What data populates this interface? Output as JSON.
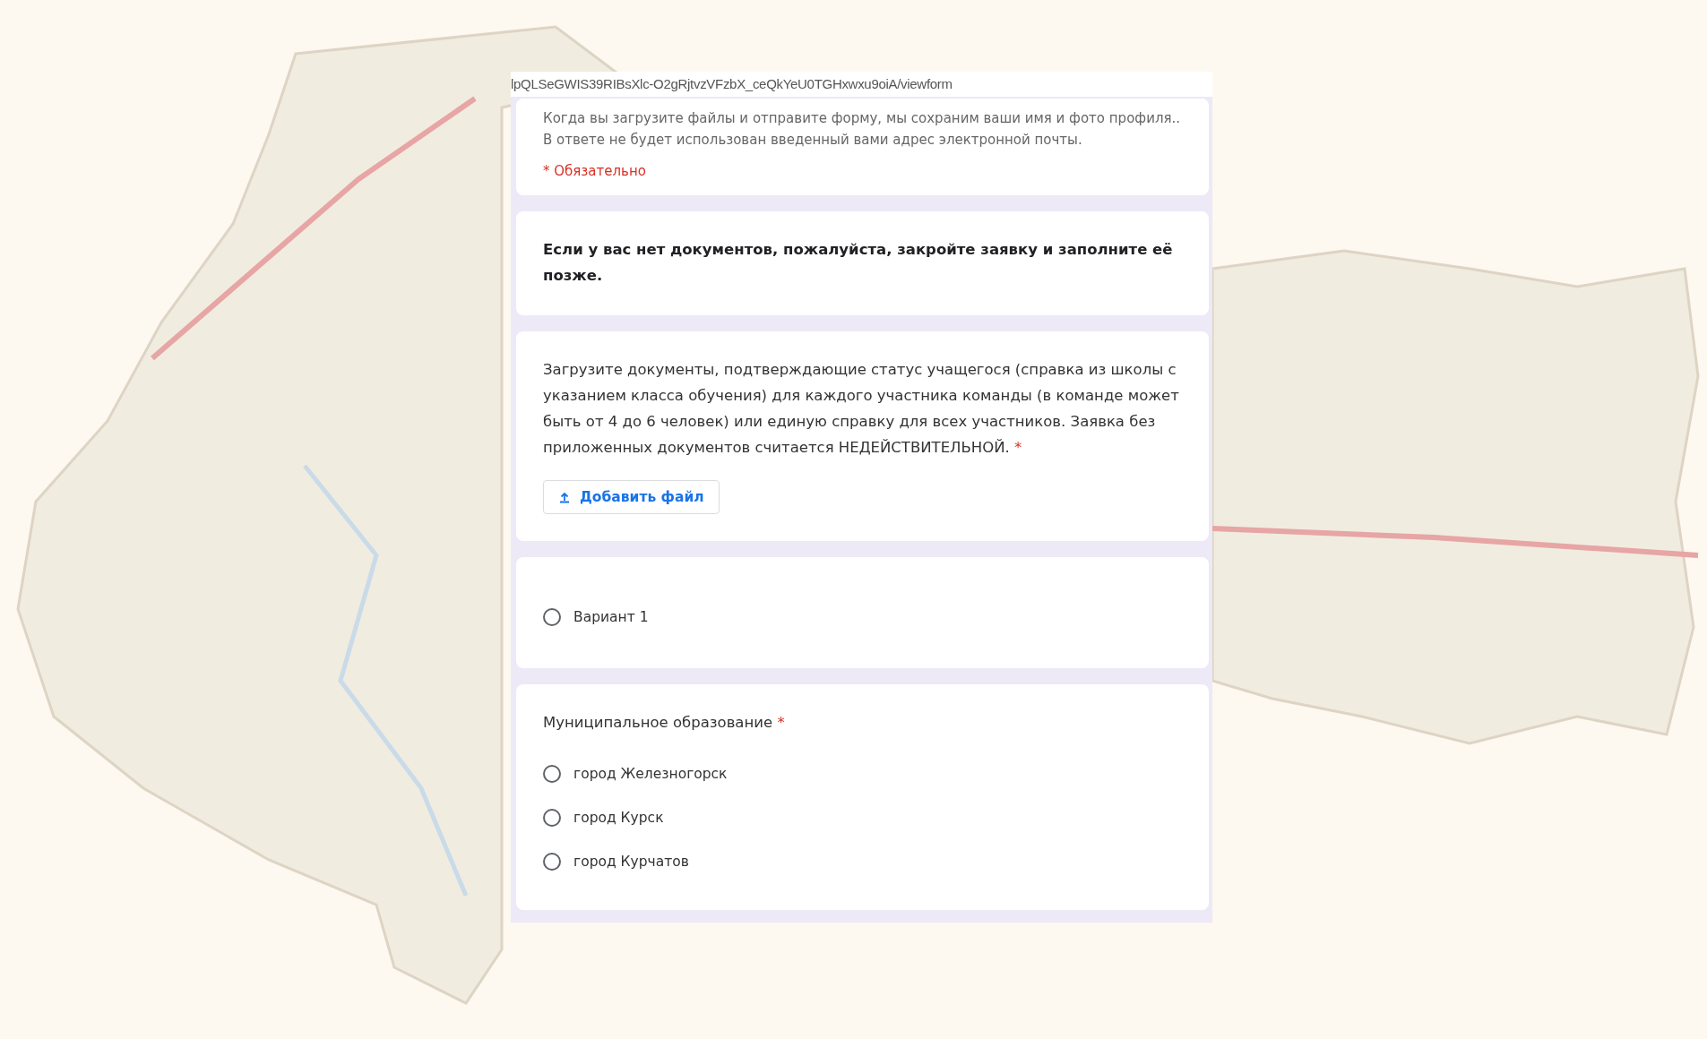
{
  "address_bar": {
    "url": "lpQLSeGWIS39RIBsXlc-O2gRjtvzVFzbX_ceQkYeU0TGHxwxu9oiA/viewform"
  },
  "header_card": {
    "note": "Когда вы загрузите файлы и отправите форму, мы сохраним ваши имя и фото профиля.. В ответе не будет использован введенный вами адрес электронной почты.",
    "required_note": "* Обязательно"
  },
  "notice_card": {
    "text": "Если у вас нет документов, пожалуйста, закройте заявку и заполните её позже."
  },
  "upload_question": {
    "text": "Загрузите документы, подтверждающие статус учащегося (справка из школы с указанием класса обучения) для каждого участника команды (в команде может быть от 4 до 6 человек) или единую справку для всех участников. Заявка без приложенных документов считается НЕДЕЙСТВИТЕЛЬНОЙ.",
    "required_mark": "*",
    "button": "Добавить файл"
  },
  "option_question": {
    "options": [
      {
        "label": "Вариант 1",
        "selected": false
      }
    ]
  },
  "municipality_question": {
    "title": "Муниципальное образование",
    "required_mark": "*",
    "options": [
      {
        "label": "город Железногорск",
        "selected": false
      },
      {
        "label": "город Курск",
        "selected": false
      },
      {
        "label": "город Курчатов",
        "selected": false
      }
    ]
  }
}
